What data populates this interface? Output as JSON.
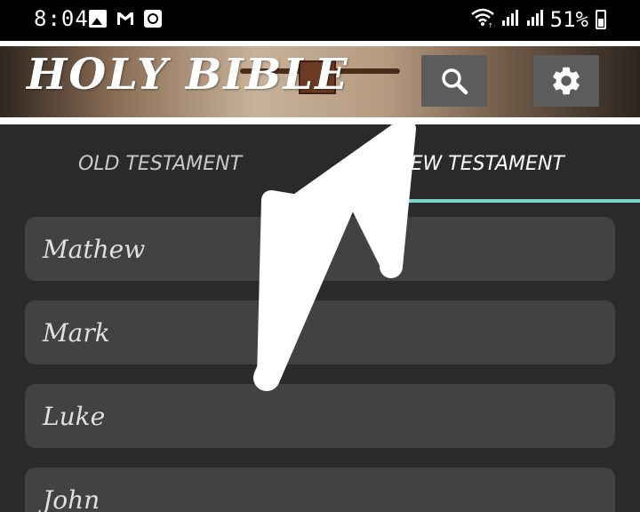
{
  "status_bar": {
    "time": "8:04",
    "battery": "51%",
    "icons_left": [
      "gallery-icon",
      "gmail-icon",
      "clock-icon"
    ],
    "icons_right": [
      "wifi-icon",
      "signal-icon",
      "signal-icon",
      "battery-icon"
    ]
  },
  "header": {
    "title": "HOLY BIBLE",
    "search_icon": "search-icon",
    "settings_icon": "gear-icon"
  },
  "tabs": [
    {
      "label": "OLD TESTAMENT",
      "selected": false
    },
    {
      "label": "NEW TESTAMENT",
      "selected": true
    }
  ],
  "books": [
    {
      "name": "Mathew"
    },
    {
      "name": "Mark"
    },
    {
      "name": "Luke"
    },
    {
      "name": "John"
    }
  ],
  "colors": {
    "tab_indicator": "#7fd3c8",
    "list_item_bg": "#424242",
    "background": "#2b2b2b"
  }
}
